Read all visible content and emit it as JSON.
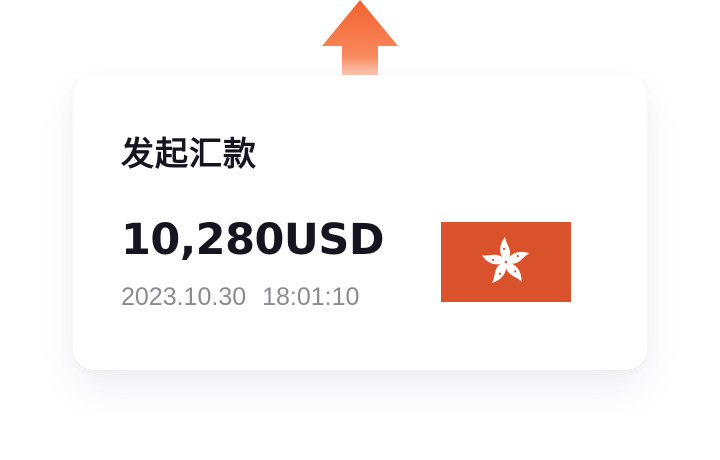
{
  "colors": {
    "arrow_top": "#f3602d",
    "arrow_bottom_fade": "#fbe2d6",
    "flag_red": "#d9522b",
    "flag_white": "#ffffff",
    "title_text": "#15151f",
    "timestamp_text": "#8a8a93",
    "card_bg": "#ffffff"
  },
  "icons": {
    "arrow": "up-arrow-icon",
    "flag": "hong-kong-flag-icon"
  },
  "card": {
    "title": "发起汇款",
    "amount": "10,280USD",
    "date": "2023.10.30",
    "time": "18:01:10"
  }
}
